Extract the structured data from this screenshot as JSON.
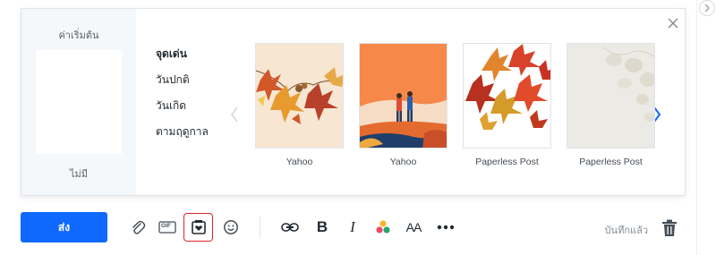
{
  "stationery_panel": {
    "left": {
      "title": "ค่าเริ่มต้น",
      "none_label": "ไม่มี"
    },
    "categories": [
      {
        "label": "จุดเด่น",
        "active": true
      },
      {
        "label": "วันปกติ",
        "active": false
      },
      {
        "label": "วันเกิด",
        "active": false
      },
      {
        "label": "ตามฤดูกาล",
        "active": false
      }
    ],
    "cards": [
      {
        "label": "Yahoo",
        "theme": "autumn-leaves-border",
        "background": "#f6e6d2"
      },
      {
        "label": "Yahoo",
        "theme": "couple-walking-autumn-hills",
        "background": "#f6884a"
      },
      {
        "label": "Paperless Post",
        "theme": "falling-maple-leaves",
        "background": "#ffffff"
      },
      {
        "label": "Paperless Post",
        "theme": "pale-dried-leaves",
        "background": "#ebeae4"
      }
    ],
    "close_icon": "close-icon",
    "prev_icon": "chevron-left-icon",
    "next_icon": "chevron-right-icon"
  },
  "toolbar": {
    "send_label": "ส่ง",
    "saved_label": "บันทึกแล้ว",
    "icons": [
      "attachment-icon",
      "gif-icon",
      "stationery-icon",
      "emoji-icon",
      "link-icon",
      "bold-icon",
      "italic-icon",
      "color-icon",
      "font-size-icon",
      "more-icon",
      "trash-icon"
    ],
    "gif_text": "GIF",
    "bold_text": "B",
    "italic_text": "I",
    "font_size_text": "AA"
  },
  "colors": {
    "send_button": "#0f69ff",
    "stationery_highlight": "#e0242b",
    "arrow_active": "#0f69ff"
  }
}
